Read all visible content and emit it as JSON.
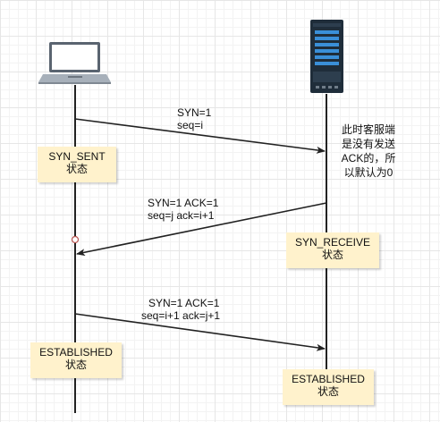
{
  "messages": {
    "syn": {
      "line1": "SYN=1",
      "line2": "seq=i"
    },
    "syn_ack": {
      "line1": "SYN=1  ACK=1",
      "line2": "seq=j  ack=i+1"
    },
    "ack": {
      "line1": "SYN=1  ACK=1",
      "line2": "seq=i+1  ack=j+1"
    }
  },
  "states": {
    "syn_sent": {
      "name": "SYN_SENT",
      "sub": "状态"
    },
    "syn_receive": {
      "name": "SYN_RECEIVE",
      "sub": "状态"
    },
    "client_established": {
      "name": "ESTABLISHED",
      "sub": "状态"
    },
    "server_established": {
      "name": "ESTABLISHED",
      "sub": "状态"
    }
  },
  "server_note": {
    "line1": "此时客服端",
    "line2": "是没有发送",
    "line3": "ACK的，所",
    "line4": "以默认为0"
  },
  "colors": {
    "note_fill": "#fff2cc",
    "line": "#222222",
    "server_body": "#1f2d3a",
    "server_panel": "#3a8fd8"
  },
  "icons": {
    "client": "laptop-icon",
    "server": "server-rack-icon"
  }
}
